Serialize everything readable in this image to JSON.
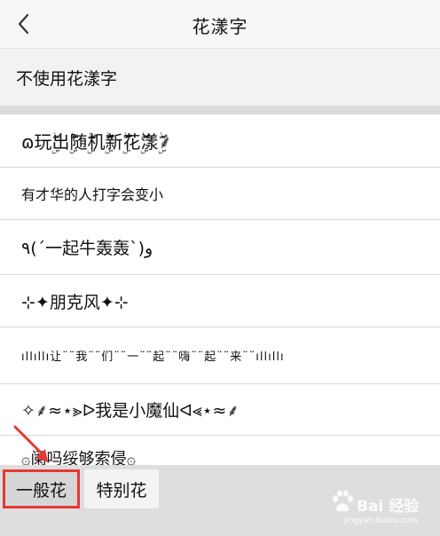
{
  "header": {
    "title": "花漾字"
  },
  "no_style_option": "不使用花漾字",
  "styles": [
    "ɷ玩ۣۖ出ۣۖ随ۣۖ机ۣۖ新ۣۖ花ۣۖ漾ۣۖ⸙",
    "有才华的人打字会变小",
    "٩(´一起牛轰轰`)و",
    "⊹✦朋克风✦⊹",
    "ıllıllı让¨¨我¨¨们¨¨一¨¨起¨¨嗨¨¨起¨¨来¨¨ıllıllı",
    "✧⸙≈⋆⪢ᐅ我是小魔仙ᐊ⪡⋆≈⸙",
    "۞阑吗绥够索侵۞"
  ],
  "tabs": {
    "general": "一般花",
    "special": "特别花"
  },
  "watermark": {
    "text": "Bai 经验",
    "url": "jingyan.baidu.com"
  },
  "colors": {
    "annotation_red": "#e53935",
    "bar_bg": "#dedede"
  }
}
